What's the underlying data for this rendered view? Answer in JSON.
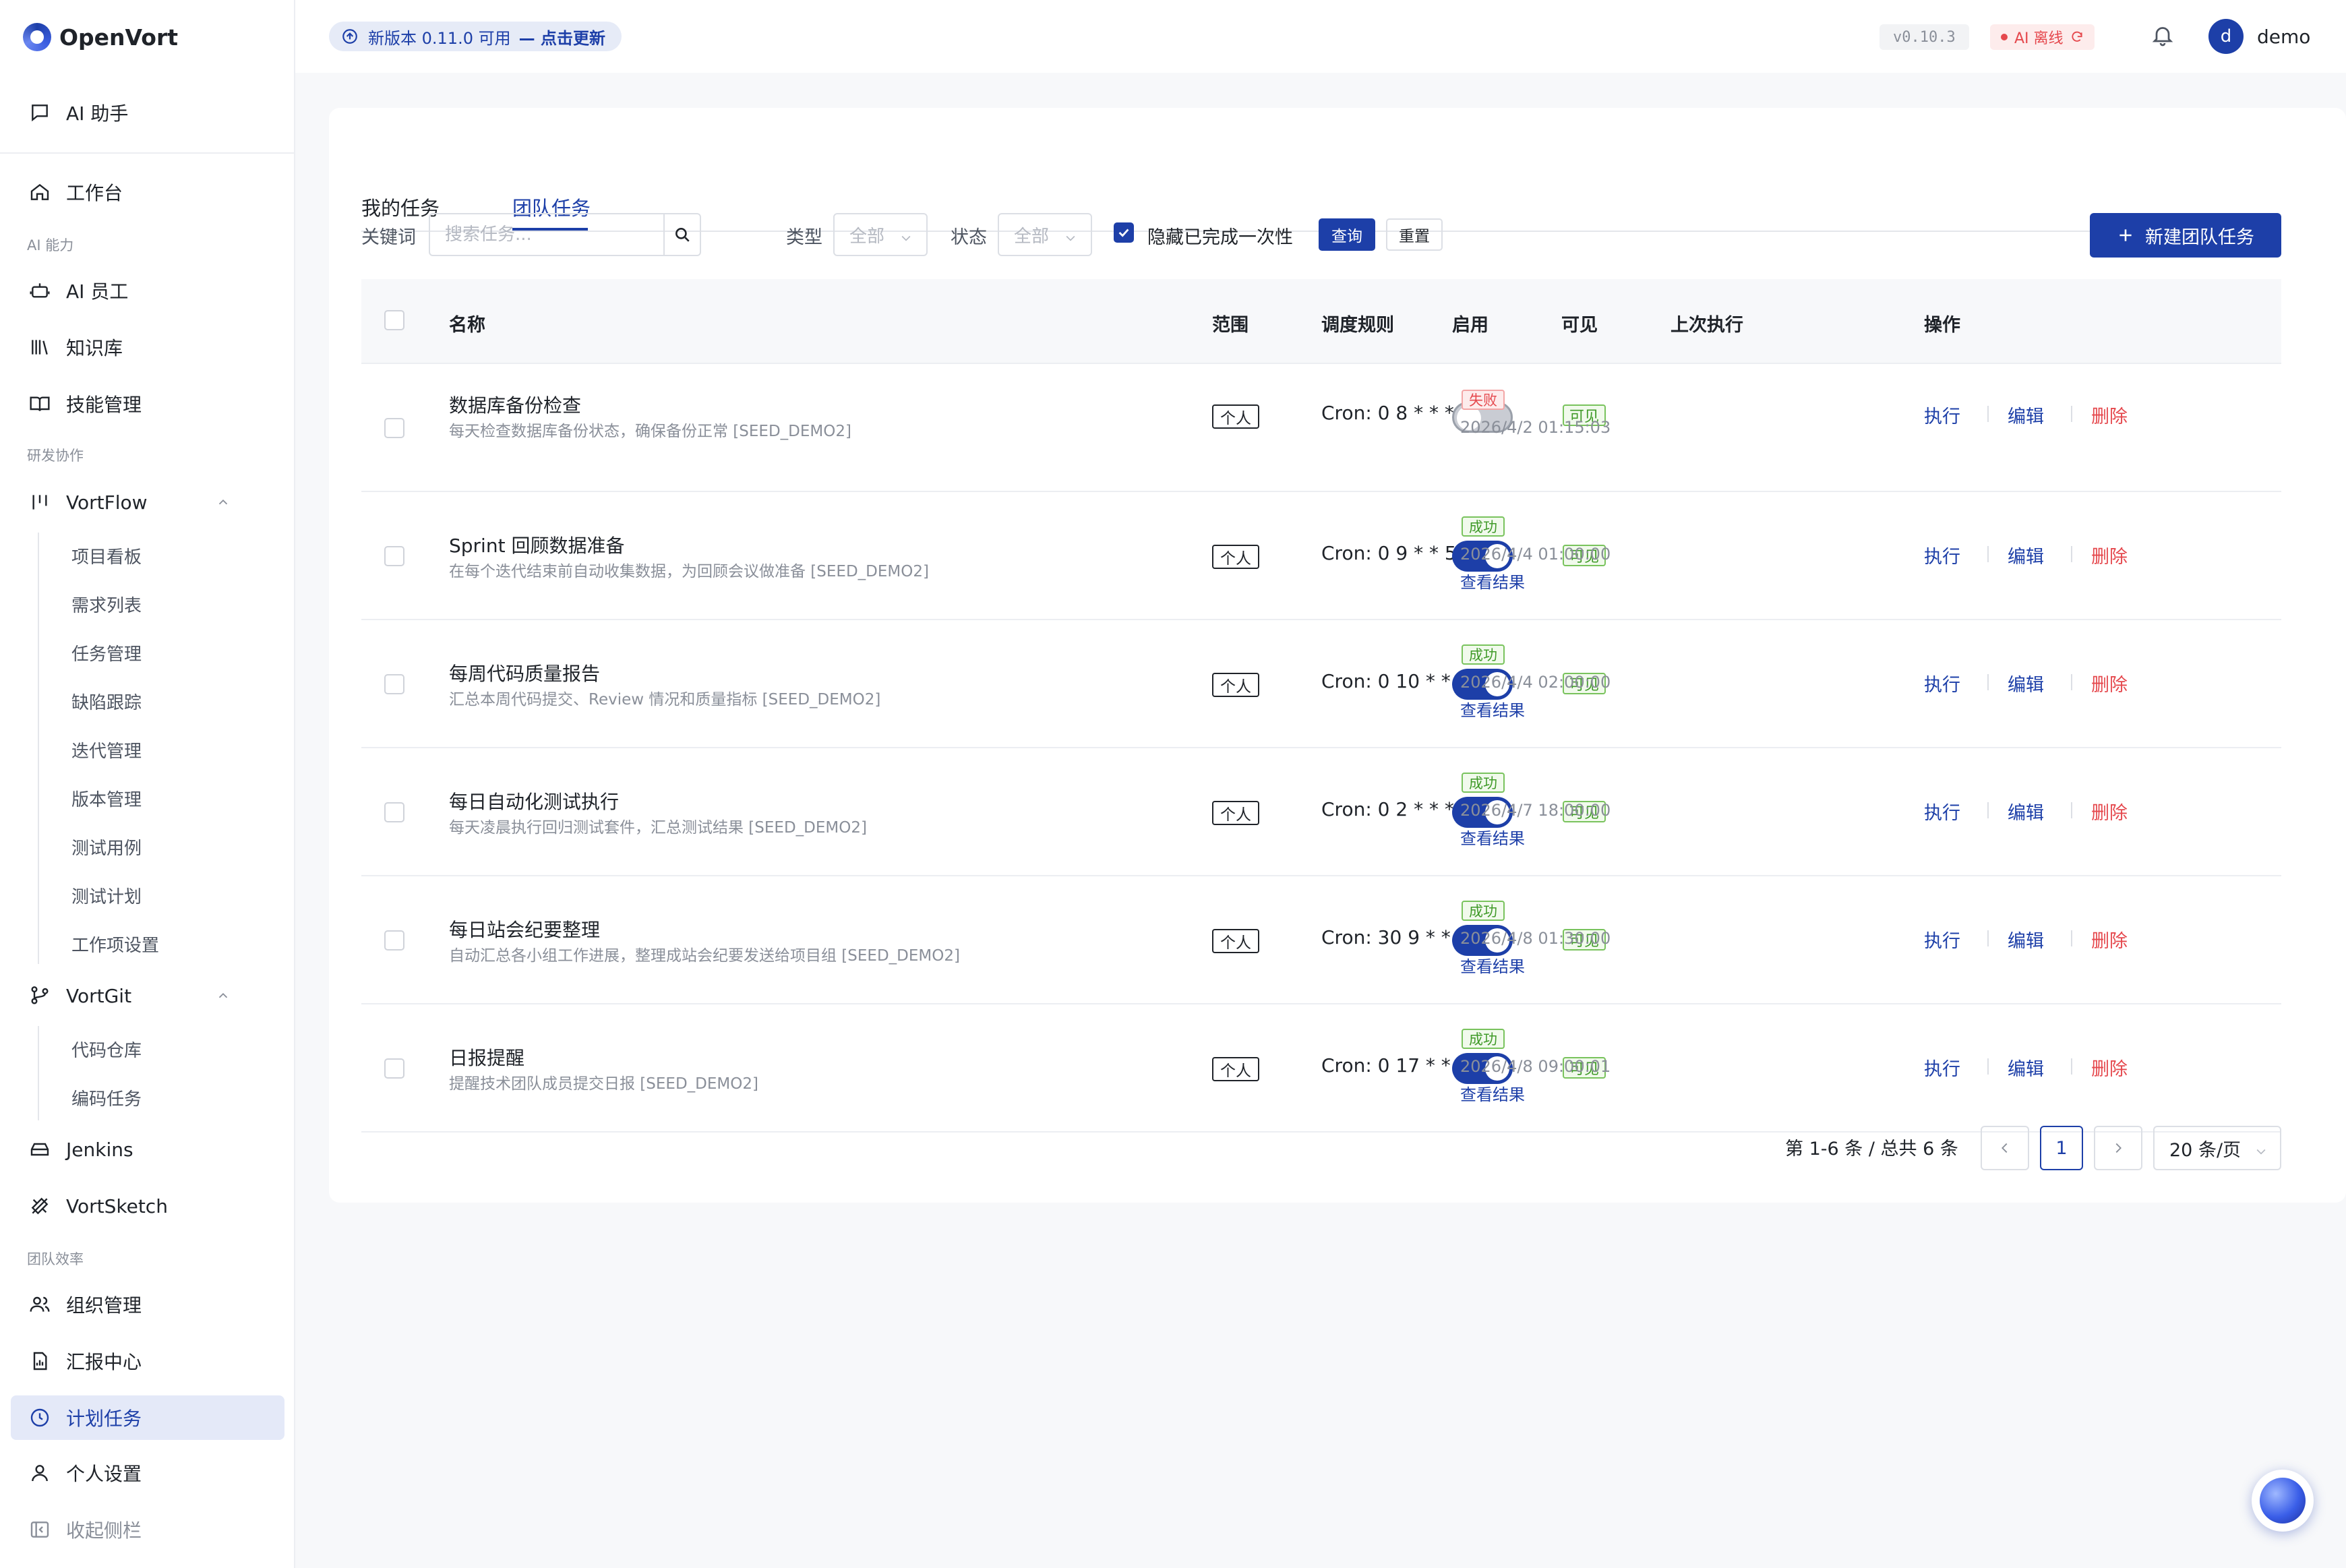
{
  "app": {
    "name": "OpenVort"
  },
  "header": {
    "update_prefix": "新版本 0.11.0 可用",
    "update_link": "— 点击更新",
    "version": "v0.10.3",
    "ai_status": "AI 离线",
    "avatar_letter": "d",
    "username": "demo"
  },
  "sidebar": {
    "ai_assistant": "AI 助手",
    "workbench": "工作台",
    "section_ai": "AI 能力",
    "ai_staff": "AI 员工",
    "knowledge": "知识库",
    "skills": "技能管理",
    "section_dev": "研发协作",
    "vortflow": "VortFlow",
    "vortflow_items": [
      "项目看板",
      "需求列表",
      "任务管理",
      "缺陷跟踪",
      "迭代管理",
      "版本管理",
      "测试用例",
      "测试计划",
      "工作项设置"
    ],
    "vortgit": "VortGit",
    "vortgit_items": [
      "代码仓库",
      "编码任务"
    ],
    "jenkins": "Jenkins",
    "vortsketch": "VortSketch",
    "section_team": "团队效率",
    "org": "组织管理",
    "reports": "汇报中心",
    "scheduled": "计划任务",
    "personal": "个人设置",
    "collapse": "收起侧栏"
  },
  "tabs": [
    "我的任务",
    "团队任务"
  ],
  "active_tab": "团队任务",
  "filters": {
    "keyword_label": "关键词",
    "search_placeholder": "搜索任务...",
    "type_label": "类型",
    "type_value": "全部",
    "status_label": "状态",
    "status_value": "全部",
    "hide_done_label": "隐藏已完成一次性",
    "hide_done_checked": true,
    "query_btn": "查询",
    "reset_btn": "重置",
    "new_btn": "新建团队任务"
  },
  "table": {
    "columns": [
      "名称",
      "范围",
      "调度规则",
      "启用",
      "可见",
      "上次执行",
      "操作"
    ],
    "actions": {
      "run": "执行",
      "edit": "编辑",
      "delete": "删除"
    },
    "result_link": "查看结果",
    "rows": [
      {
        "name": "数据库备份检查",
        "desc": "每天检查数据库备份状态，确保备份正常 [SEED_DEMO2]",
        "scope": "个人",
        "cron": "Cron: 0 8 * * *",
        "enabled": false,
        "visible": "可见",
        "status": "失败",
        "status_ok": false,
        "time": "2026/4/2 01:15:03",
        "has_result": false
      },
      {
        "name": "Sprint 回顾数据准备",
        "desc": "在每个迭代结束前自动收集数据，为回顾会议做准备 [SEED_DEMO2]",
        "scope": "个人",
        "cron": "Cron: 0 9 * * 5",
        "enabled": true,
        "visible": "可见",
        "status": "成功",
        "status_ok": true,
        "time": "2026/4/4 01:00:00",
        "has_result": true
      },
      {
        "name": "每周代码质量报告",
        "desc": "汇总本周代码提交、Review 情况和质量指标 [SEED_DEMO2]",
        "scope": "个人",
        "cron": "Cron: 0 10 * * 5",
        "enabled": true,
        "visible": "可见",
        "status": "成功",
        "status_ok": true,
        "time": "2026/4/4 02:00:00",
        "has_result": true
      },
      {
        "name": "每日自动化测试执行",
        "desc": "每天凌晨执行回归测试套件，汇总测试结果 [SEED_DEMO2]",
        "scope": "个人",
        "cron": "Cron: 0 2 * * *",
        "enabled": true,
        "visible": "可见",
        "status": "成功",
        "status_ok": true,
        "time": "2026/4/7 18:00:00",
        "has_result": true
      },
      {
        "name": "每日站会纪要整理",
        "desc": "自动汇总各小组工作进展，整理成站会纪要发送给项目组 [SEED_DEMO2]",
        "scope": "个人",
        "cron": "Cron: 30 9 * * 1-5",
        "enabled": true,
        "visible": "可见",
        "status": "成功",
        "status_ok": true,
        "time": "2026/4/8 01:30:00",
        "has_result": true
      },
      {
        "name": "日报提醒",
        "desc": "提醒技术团队成员提交日报 [SEED_DEMO2]",
        "scope": "个人",
        "cron": "Cron: 0 17 * * 1-5",
        "enabled": true,
        "visible": "可见",
        "status": "成功",
        "status_ok": true,
        "time": "2026/4/8 09:00:01",
        "has_result": true
      }
    ]
  },
  "pagination": {
    "summary": "第 1-6 条 / 总共 6 条",
    "current_page": "1",
    "page_size": "20 条/页"
  },
  "colors": {
    "primary": "#1d3fa8",
    "danger": "#e5484d",
    "success": "#3f9a28"
  }
}
